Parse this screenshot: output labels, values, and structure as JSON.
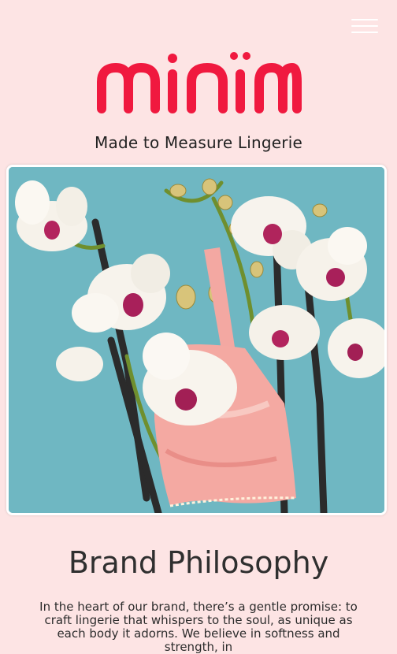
{
  "header": {
    "menu_icon": "hamburger-icon",
    "logo_text": "minïm",
    "tagline": "Made to Measure Lingerie"
  },
  "hero": {
    "image_description": "pink lingerie among white orchids"
  },
  "philosophy": {
    "title": "Brand Philosophy",
    "body": "In the heart of our brand, there’s a gentle promise: to craft lingerie that whispers to the soul, as unique as each body it adorns. We believe in softness and strength, in"
  },
  "colors": {
    "background": "#fde4e4",
    "brand": "#f0193f",
    "hero_bg": "#6fb7c2",
    "satin": "#f3a8a2"
  }
}
